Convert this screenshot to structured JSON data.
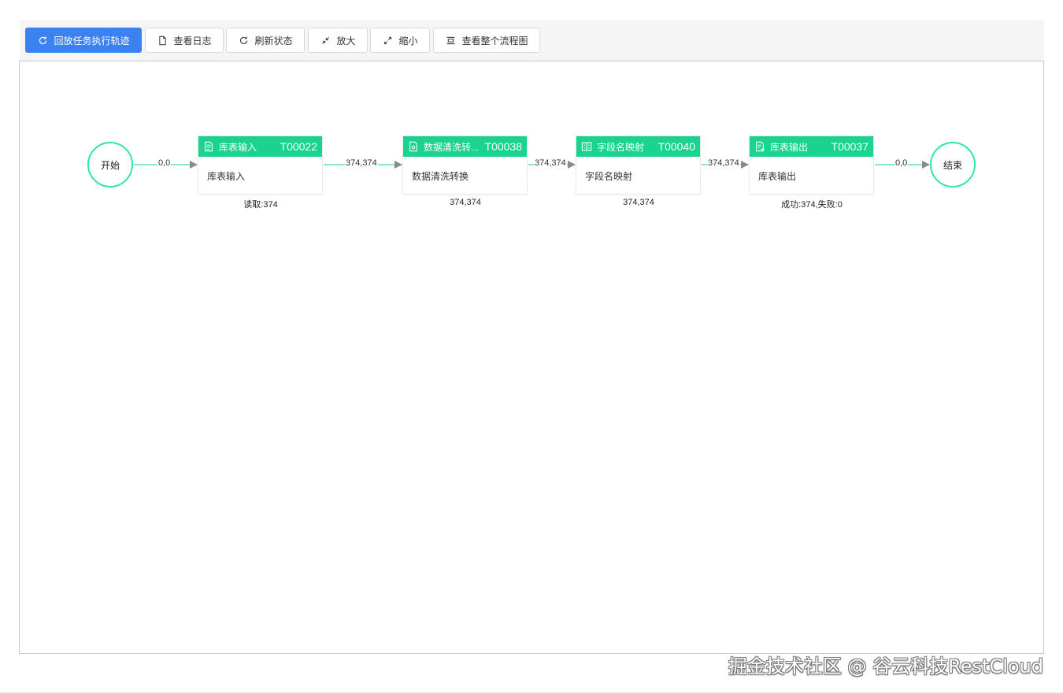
{
  "toolbar": {
    "replay": "回放任务执行轨迹",
    "view_log": "查看日志",
    "refresh": "刷新状态",
    "zoom_in": "放大",
    "zoom_out": "缩小",
    "full_view": "查看整个流程图"
  },
  "flow": {
    "start": "开始",
    "end": "结束",
    "nodes": [
      {
        "name": "库表输入",
        "code": "T00022",
        "body": "库表输入",
        "stat": "读取:374"
      },
      {
        "name": "数据清洗转...",
        "code": "T00038",
        "body": "数据清洗转换",
        "stat": "374,374"
      },
      {
        "name": "字段名映射",
        "code": "T00040",
        "body": "字段名映射",
        "stat": "374,374"
      },
      {
        "name": "库表输出",
        "code": "T00037",
        "body": "库表输出",
        "stat": "成功:374,失败:0"
      }
    ],
    "edges": [
      "0,0",
      "374,374",
      "374,374",
      "374,374",
      "0,0"
    ]
  },
  "colors": {
    "primary": "#3b82f0",
    "node_header": "#19d38e",
    "circle_border": "#2ee6a8",
    "edge": "#5ee0b8"
  },
  "watermark": "掘金技术社区 @ 谷云科技RestCloud"
}
